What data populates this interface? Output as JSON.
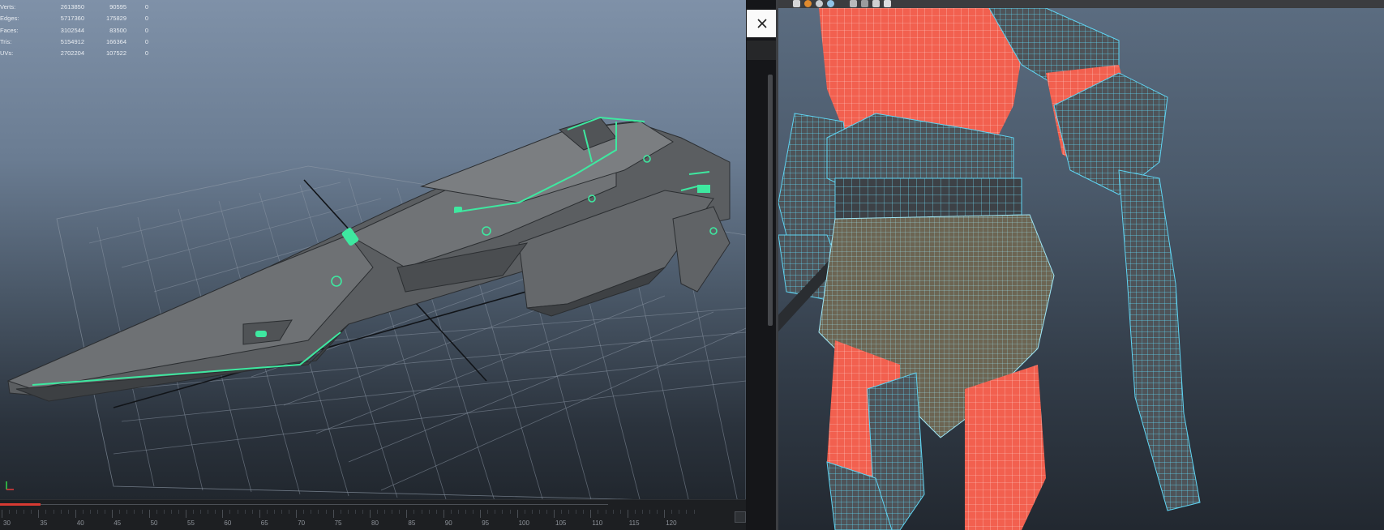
{
  "hud": {
    "rows": [
      {
        "label": "Verts:",
        "v1": "2613850",
        "v2": "90595",
        "v3": "0"
      },
      {
        "label": "Edges:",
        "v1": "5717360",
        "v2": "175829",
        "v3": "0"
      },
      {
        "label": "Faces:",
        "v1": "3102544",
        "v2": "83500",
        "v3": "0"
      },
      {
        "label": "Tris:",
        "v1": "5154912",
        "v2": "166364",
        "v3": "0"
      },
      {
        "label": "UVs:",
        "v1": "2702204",
        "v2": "107522",
        "v3": "0"
      }
    ]
  },
  "timeline": {
    "ticks": [
      "30",
      "35",
      "40",
      "45",
      "50",
      "55",
      "60",
      "65",
      "70",
      "75",
      "80",
      "85",
      "90",
      "95",
      "100",
      "105",
      "110",
      "115",
      "120"
    ]
  },
  "close_icon": "close-icon",
  "colors": {
    "accent_glow": "#3ee8a0",
    "wire_cyan": "#5fd4f2",
    "skin_red": "#f2604f",
    "playhead": "#d83a32"
  }
}
